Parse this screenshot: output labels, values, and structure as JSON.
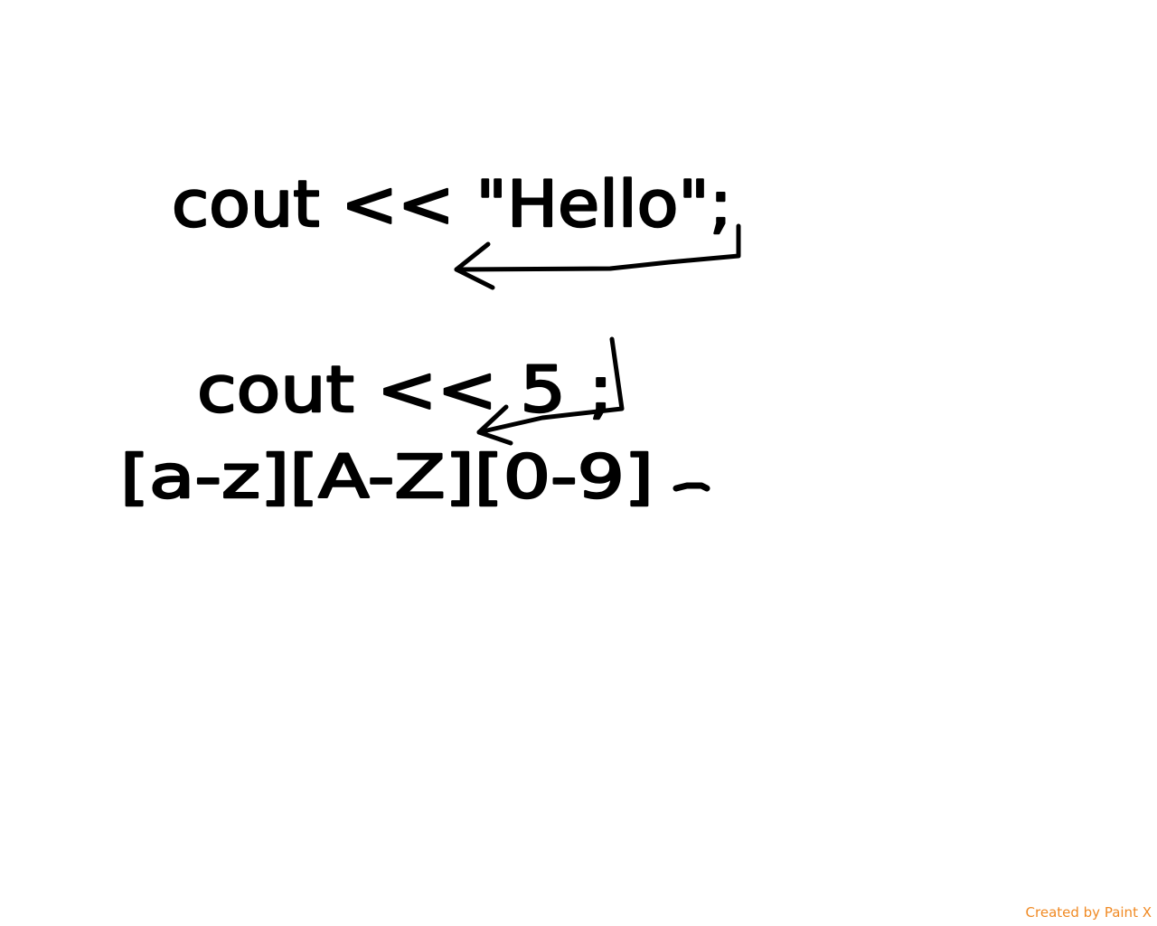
{
  "canvas": {
    "background": "#ffffff",
    "ink_color": "#000000"
  },
  "handwriting": {
    "line1": "cout << \"Hello\";",
    "line2": "cout << 5 ;",
    "line3": "[a-z][A-Z][0-9]"
  },
  "watermark": {
    "text": "Created by Paint X",
    "color": "#f08a24"
  }
}
